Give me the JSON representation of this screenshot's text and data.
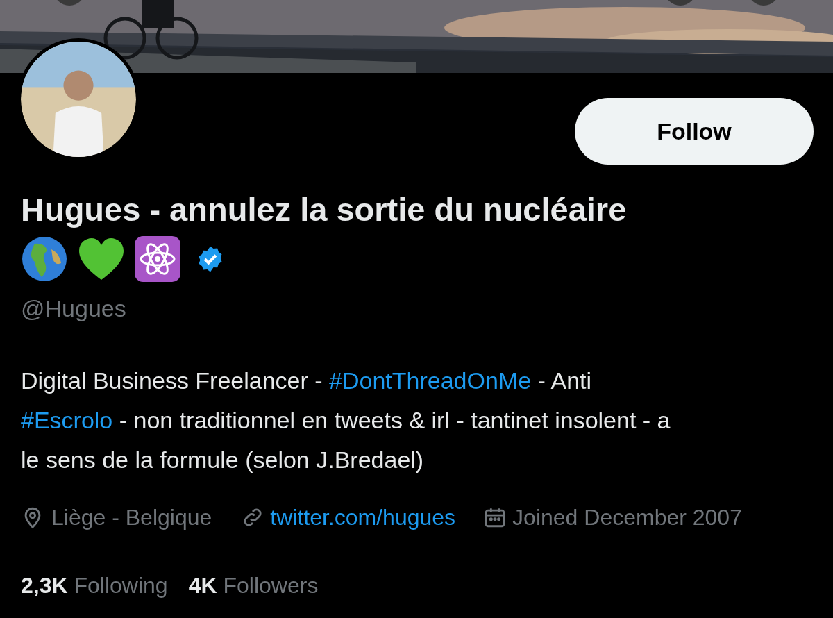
{
  "profile": {
    "name": "Hugues - annulez la sortie du nucléaire",
    "verified": true,
    "handle": "@Hugues",
    "follow_button": "Follow",
    "bio": [
      {
        "kind": "text",
        "text": "Digital Business Freelancer - "
      },
      {
        "kind": "hashtag",
        "text": "#DontThreadOnMe"
      },
      {
        "kind": "text",
        "text": " - Anti "
      },
      {
        "kind": "hashtag",
        "text": "#Escrolo"
      },
      {
        "kind": "text",
        "text": " - non traditionnel en tweets & irl - tantinet insolent - a le sens de la formule (selon J.Bredael)"
      }
    ],
    "location": "Liège - Belgique",
    "website": "twitter.com/hugues",
    "joined": "Joined December 2007",
    "stats": [
      {
        "count": "2,3K",
        "label": "Following"
      },
      {
        "count": "4K",
        "label": "Followers"
      }
    ]
  }
}
